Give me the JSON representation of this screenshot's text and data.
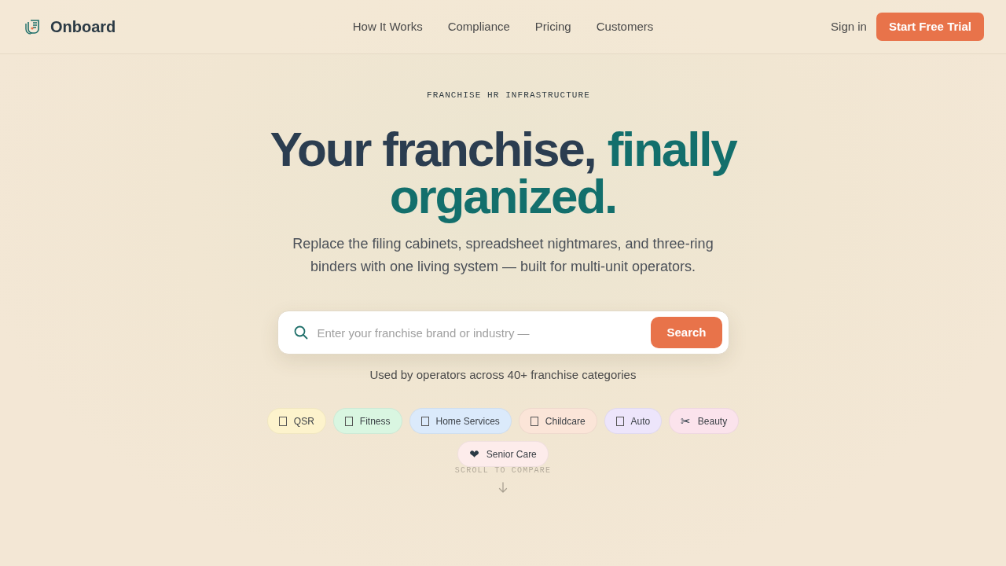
{
  "nav": {
    "brand": "Onboard",
    "links": [
      "How It Works",
      "Compliance",
      "Pricing",
      "Customers"
    ],
    "sign_in": "Sign in",
    "cta": "Start Free Trial"
  },
  "hero": {
    "eyebrow": "FRANCHISE HR INFRASTRUCTURE",
    "headline": {
      "lead": "Your franchise,",
      "accent": "finally organized."
    },
    "subtitle": "Replace the filing cabinets, spreadsheet nightmares, and three-ring binders with one living system — built for multi-unit operators.",
    "search": {
      "placeholder": "Enter your franchise brand or industry —",
      "button": "Search"
    },
    "social_proof": "Used by operators across 40+ franchise categories",
    "categories": [
      {
        "label": "QSR",
        "kind": "blank",
        "color": "#fdf3cc"
      },
      {
        "label": "Fitness",
        "kind": "blank",
        "color": "#d9f6e1"
      },
      {
        "label": "Home Services",
        "kind": "blank",
        "color": "#dbeafb"
      },
      {
        "label": "Childcare",
        "kind": "blank",
        "color": "#fbe5d8"
      },
      {
        "label": "Auto",
        "kind": "blank",
        "color": "#ede5fb"
      },
      {
        "label": "Beauty",
        "kind": "glyph",
        "glyph": "✂",
        "color": "#fbe3ec"
      },
      {
        "label": "Senior Care",
        "kind": "glyph",
        "glyph": "❤",
        "color": "#fdeceb"
      }
    ],
    "scroll_hint": "SCROLL TO COMPARE"
  }
}
